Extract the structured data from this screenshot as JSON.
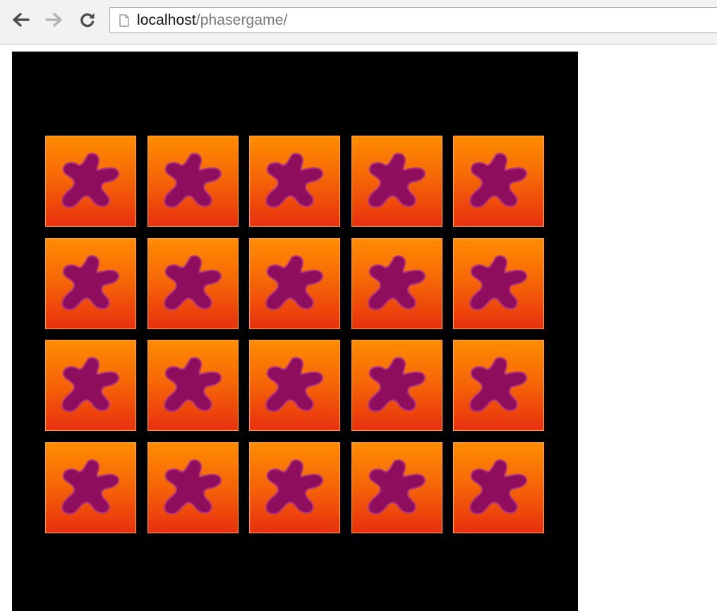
{
  "browser": {
    "url_host": "localhost",
    "url_path": "/phasergame/",
    "icons": {
      "back": "back-arrow-icon",
      "forward": "forward-arrow-icon",
      "reload": "reload-icon",
      "page": "page-icon"
    }
  },
  "game": {
    "background": "#000000",
    "grid": {
      "rows": 4,
      "columns": 5
    },
    "tiles": [
      {
        "icon": "purple-splat-icon"
      },
      {
        "icon": "purple-splat-icon"
      },
      {
        "icon": "purple-splat-icon"
      },
      {
        "icon": "purple-splat-icon"
      },
      {
        "icon": "purple-splat-icon"
      },
      {
        "icon": "purple-splat-icon"
      },
      {
        "icon": "purple-splat-icon"
      },
      {
        "icon": "purple-splat-icon"
      },
      {
        "icon": "purple-splat-icon"
      },
      {
        "icon": "purple-splat-icon"
      },
      {
        "icon": "purple-splat-icon"
      },
      {
        "icon": "purple-splat-icon"
      },
      {
        "icon": "purple-splat-icon"
      },
      {
        "icon": "purple-splat-icon"
      },
      {
        "icon": "purple-splat-icon"
      },
      {
        "icon": "purple-splat-icon"
      },
      {
        "icon": "purple-splat-icon"
      },
      {
        "icon": "purple-splat-icon"
      },
      {
        "icon": "purple-splat-icon"
      },
      {
        "icon": "purple-splat-icon"
      }
    ],
    "colors": {
      "tile_top": "#ff8c00",
      "tile_bottom": "#e8300f",
      "splat_fill": "#8e0d5c",
      "splat_stroke": "#b1337c"
    }
  }
}
